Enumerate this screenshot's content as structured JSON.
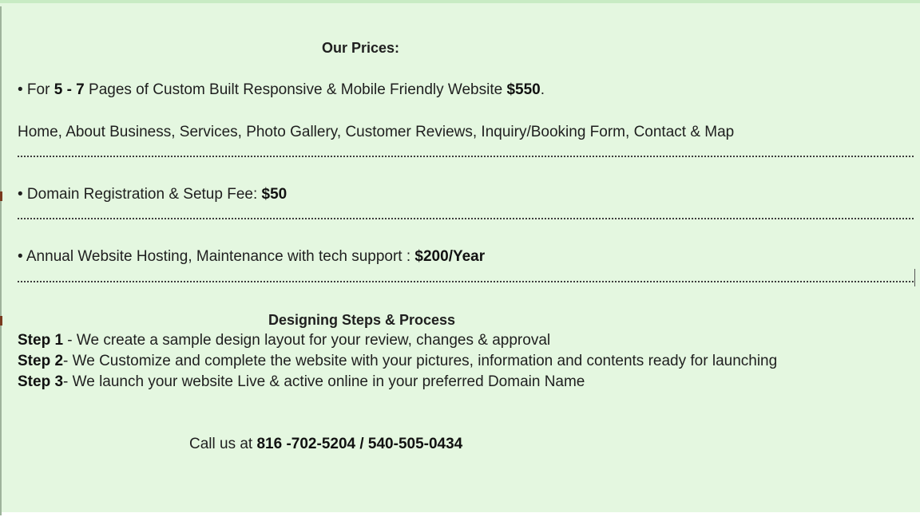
{
  "prices": {
    "title": "Our Prices:",
    "pages_line": {
      "prefix": "• For ",
      "range": "5 - 7",
      "middle": " Pages of Custom Built Responsive & Mobile Friendly Website ",
      "price": "$550",
      "suffix": "."
    },
    "pages_list": "Home, About Business, Services, Photo Gallery, Customer Reviews, Inquiry/Booking Form, Contact & Map",
    "domain_line": {
      "text": "• Domain Registration & Setup Fee: ",
      "price": "$50"
    },
    "hosting_line": {
      "text": "• Annual Website Hosting, Maintenance with tech support : ",
      "price": "$200/Year"
    }
  },
  "process": {
    "title": "Designing Steps & Process",
    "steps": [
      {
        "label": "Step 1",
        "text": " - We create a sample design layout for your review, changes & approval"
      },
      {
        "label": "Step 2",
        "text": "- We Customize and complete the website with your pictures, information and contents ready for launching"
      },
      {
        "label": "Step 3",
        "text": "- We launch  your website Live & active online in your preferred Domain Name"
      }
    ]
  },
  "contact": {
    "prefix": "Call us at ",
    "phones": "816 -702-5204 / 540-505-0434"
  },
  "colors": {
    "background": "#e4f7e0",
    "text": "#1f1f1f"
  }
}
